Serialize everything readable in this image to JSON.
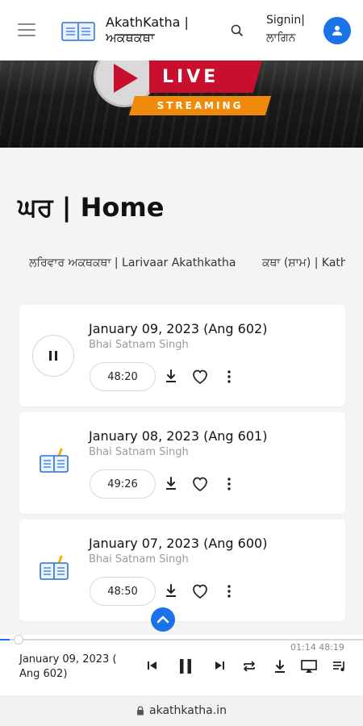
{
  "header": {
    "brand_line1": "AkathKatha |",
    "brand_line2": "ਅਕਥਕਥਾ",
    "signin_line1": "Signin|",
    "signin_line2": "ਲਾਗਿਨ"
  },
  "banner": {
    "live": "LIVE",
    "streaming": "STREAMING",
    "colors": {
      "live_red": "#c8102e",
      "streaming_orange": "#f08a0a"
    }
  },
  "page": {
    "title": "ਘਰ | Home"
  },
  "categories": [
    "ਲਰਿਵਾਰ ਅਕਥਕਥਾ | Larivaar Akathkatha",
    "ਕਥਾ (ਸ਼ਾਮ) | Kath"
  ],
  "tracks": [
    {
      "title": "January 09, 2023 (Ang 602)",
      "author": "Bhai Satnam Singh",
      "duration": "48:20",
      "state": "playing",
      "icon": "pause-icon"
    },
    {
      "title": "January 08, 2023 (Ang 601)",
      "author": "Bhai Satnam Singh",
      "duration": "49:26",
      "state": "idle",
      "icon": "book-icon"
    },
    {
      "title": "January 07, 2023 (Ang 600)",
      "author": "Bhai Satnam Singh",
      "duration": "48:50",
      "state": "idle",
      "icon": "book-icon"
    }
  ],
  "player": {
    "now_playing": "January 09, 2023 ( Ang 602)",
    "elapsed": "01:14",
    "total": "48:19",
    "progress": 0.026
  },
  "browser": {
    "url": "akathkatha.in"
  },
  "theme": {
    "accent": "#1a73e8"
  }
}
